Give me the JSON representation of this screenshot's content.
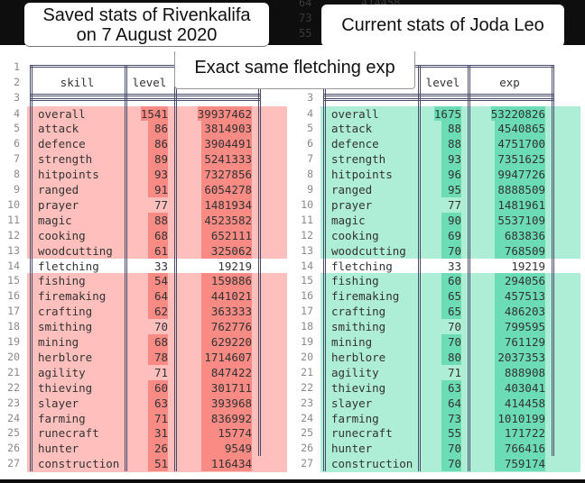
{
  "background_faint": {
    "row_numbers": [
      "64",
      "73",
      "55"
    ],
    "value": "414458"
  },
  "callouts": {
    "saved_title_line1": "Saved stats of Rivenkalifa",
    "saved_title_line2": "on 7 August 2020",
    "current_title": "Current stats of Joda Leo",
    "note": "Exact same fletching exp"
  },
  "colors": {
    "saved_row_bg": "#ffc0bd",
    "saved_diff_highlight": "#f98a84",
    "current_row_bg": "#aeedd6",
    "current_diff_highlight": "#6cdcb6",
    "same_row_bg": "#ffffff"
  },
  "headers": {
    "skill": "skill",
    "level": "level",
    "exp": "exp"
  },
  "gutter_header_rows": [
    "1",
    "2",
    "3"
  ],
  "saved": {
    "player": "Rivenkalifa",
    "rows": [
      {
        "n": "4",
        "skill": "overall",
        "level": "1541",
        "exp": "39937462",
        "level_diff": true,
        "exp_diff": true
      },
      {
        "n": "5",
        "skill": "attack",
        "level": "86",
        "exp": "3814903",
        "level_diff": true,
        "exp_diff": true
      },
      {
        "n": "6",
        "skill": "defence",
        "level": "86",
        "exp": "3904491",
        "level_diff": true,
        "exp_diff": true
      },
      {
        "n": "7",
        "skill": "strength",
        "level": "89",
        "exp": "5241333",
        "level_diff": true,
        "exp_diff": true
      },
      {
        "n": "8",
        "skill": "hitpoints",
        "level": "93",
        "exp": "7327856",
        "level_diff": true,
        "exp_diff": true
      },
      {
        "n": "9",
        "skill": "ranged",
        "level": "91",
        "exp": "6054278",
        "level_diff": true,
        "exp_diff": true
      },
      {
        "n": "10",
        "skill": "prayer",
        "level": "77",
        "exp": "1481934",
        "level_diff": false,
        "exp_diff": true
      },
      {
        "n": "11",
        "skill": "magic",
        "level": "88",
        "exp": "4523582",
        "level_diff": true,
        "exp_diff": true
      },
      {
        "n": "12",
        "skill": "cooking",
        "level": "68",
        "exp": "652111",
        "level_diff": true,
        "exp_diff": true
      },
      {
        "n": "13",
        "skill": "woodcutting",
        "level": "61",
        "exp": "325062",
        "level_diff": true,
        "exp_diff": true
      },
      {
        "n": "14",
        "skill": "fletching",
        "level": "33",
        "exp": "19219",
        "level_diff": false,
        "exp_diff": false,
        "same": true
      },
      {
        "n": "15",
        "skill": "fishing",
        "level": "54",
        "exp": "159886",
        "level_diff": true,
        "exp_diff": true
      },
      {
        "n": "16",
        "skill": "firemaking",
        "level": "64",
        "exp": "441021",
        "level_diff": true,
        "exp_diff": true
      },
      {
        "n": "17",
        "skill": "crafting",
        "level": "62",
        "exp": "363333",
        "level_diff": true,
        "exp_diff": true
      },
      {
        "n": "18",
        "skill": "smithing",
        "level": "70",
        "exp": "762776",
        "level_diff": false,
        "exp_diff": true
      },
      {
        "n": "19",
        "skill": "mining",
        "level": "68",
        "exp": "629220",
        "level_diff": true,
        "exp_diff": true
      },
      {
        "n": "20",
        "skill": "herblore",
        "level": "78",
        "exp": "1714607",
        "level_diff": true,
        "exp_diff": true
      },
      {
        "n": "21",
        "skill": "agility",
        "level": "71",
        "exp": "847422",
        "level_diff": false,
        "exp_diff": true
      },
      {
        "n": "22",
        "skill": "thieving",
        "level": "60",
        "exp": "301711",
        "level_diff": true,
        "exp_diff": true
      },
      {
        "n": "23",
        "skill": "slayer",
        "level": "63",
        "exp": "393968",
        "level_diff": true,
        "exp_diff": true
      },
      {
        "n": "24",
        "skill": "farming",
        "level": "71",
        "exp": "836992",
        "level_diff": true,
        "exp_diff": true
      },
      {
        "n": "25",
        "skill": "runecraft",
        "level": "31",
        "exp": "15774",
        "level_diff": true,
        "exp_diff": true
      },
      {
        "n": "26",
        "skill": "hunter",
        "level": "26",
        "exp": "9549",
        "level_diff": true,
        "exp_diff": true
      },
      {
        "n": "27",
        "skill": "construction",
        "level": "51",
        "exp": "116434",
        "level_diff": true,
        "exp_diff": true
      }
    ]
  },
  "current": {
    "player": "Joda Leo",
    "rows": [
      {
        "n": "4",
        "skill": "overall",
        "level": "1675",
        "exp": "53220826",
        "level_diff": true,
        "exp_diff": true
      },
      {
        "n": "5",
        "skill": "attack",
        "level": "88",
        "exp": "4540865",
        "level_diff": true,
        "exp_diff": true
      },
      {
        "n": "6",
        "skill": "defence",
        "level": "88",
        "exp": "4751700",
        "level_diff": true,
        "exp_diff": true
      },
      {
        "n": "7",
        "skill": "strength",
        "level": "93",
        "exp": "7351625",
        "level_diff": true,
        "exp_diff": true
      },
      {
        "n": "8",
        "skill": "hitpoints",
        "level": "96",
        "exp": "9947726",
        "level_diff": true,
        "exp_diff": true
      },
      {
        "n": "9",
        "skill": "ranged",
        "level": "95",
        "exp": "8888509",
        "level_diff": true,
        "exp_diff": true
      },
      {
        "n": "10",
        "skill": "prayer",
        "level": "77",
        "exp": "1481961",
        "level_diff": false,
        "exp_diff": true
      },
      {
        "n": "11",
        "skill": "magic",
        "level": "90",
        "exp": "5537109",
        "level_diff": true,
        "exp_diff": true
      },
      {
        "n": "12",
        "skill": "cooking",
        "level": "69",
        "exp": "683836",
        "level_diff": true,
        "exp_diff": true
      },
      {
        "n": "13",
        "skill": "woodcutting",
        "level": "70",
        "exp": "768509",
        "level_diff": true,
        "exp_diff": true
      },
      {
        "n": "14",
        "skill": "fletching",
        "level": "33",
        "exp": "19219",
        "level_diff": false,
        "exp_diff": false,
        "same": true
      },
      {
        "n": "15",
        "skill": "fishing",
        "level": "60",
        "exp": "294056",
        "level_diff": true,
        "exp_diff": true
      },
      {
        "n": "16",
        "skill": "firemaking",
        "level": "65",
        "exp": "457513",
        "level_diff": true,
        "exp_diff": true
      },
      {
        "n": "17",
        "skill": "crafting",
        "level": "65",
        "exp": "486203",
        "level_diff": true,
        "exp_diff": true
      },
      {
        "n": "18",
        "skill": "smithing",
        "level": "70",
        "exp": "799595",
        "level_diff": false,
        "exp_diff": true
      },
      {
        "n": "19",
        "skill": "mining",
        "level": "70",
        "exp": "761129",
        "level_diff": true,
        "exp_diff": true
      },
      {
        "n": "20",
        "skill": "herblore",
        "level": "80",
        "exp": "2037353",
        "level_diff": true,
        "exp_diff": true
      },
      {
        "n": "21",
        "skill": "agility",
        "level": "71",
        "exp": "888908",
        "level_diff": false,
        "exp_diff": true
      },
      {
        "n": "22",
        "skill": "thieving",
        "level": "63",
        "exp": "403041",
        "level_diff": true,
        "exp_diff": true
      },
      {
        "n": "23",
        "skill": "slayer",
        "level": "64",
        "exp": "414458",
        "level_diff": true,
        "exp_diff": true
      },
      {
        "n": "24",
        "skill": "farming",
        "level": "73",
        "exp": "1010199",
        "level_diff": true,
        "exp_diff": true
      },
      {
        "n": "25",
        "skill": "runecraft",
        "level": "55",
        "exp": "171722",
        "level_diff": true,
        "exp_diff": true
      },
      {
        "n": "26",
        "skill": "hunter",
        "level": "70",
        "exp": "766416",
        "level_diff": true,
        "exp_diff": true
      },
      {
        "n": "27",
        "skill": "construction",
        "level": "70",
        "exp": "759174",
        "level_diff": true,
        "exp_diff": true
      }
    ]
  }
}
